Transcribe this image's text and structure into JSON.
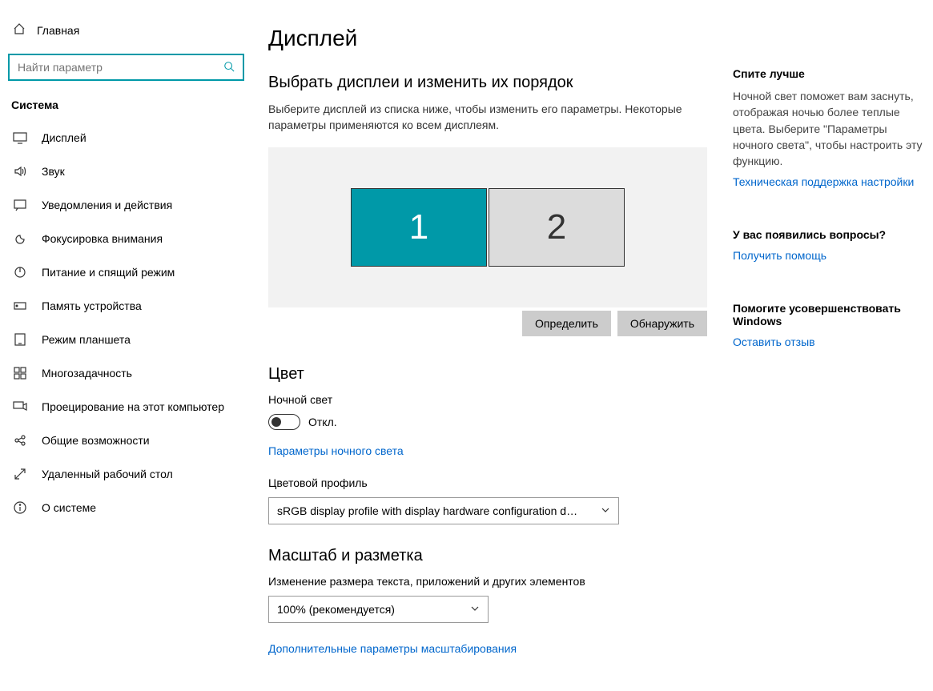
{
  "sidebar": {
    "home": "Главная",
    "search_placeholder": "Найти параметр",
    "category": "Система",
    "items": [
      {
        "label": "Дисплей"
      },
      {
        "label": "Звук"
      },
      {
        "label": "Уведомления и действия"
      },
      {
        "label": "Фокусировка внимания"
      },
      {
        "label": "Питание и спящий режим"
      },
      {
        "label": "Память устройства"
      },
      {
        "label": "Режим планшета"
      },
      {
        "label": "Многозадачность"
      },
      {
        "label": "Проецирование на этот компьютер"
      },
      {
        "label": "Общие возможности"
      },
      {
        "label": "Удаленный рабочий стол"
      },
      {
        "label": "О системе"
      }
    ]
  },
  "main": {
    "title": "Дисплей",
    "arrange": {
      "heading": "Выбрать дисплеи и изменить их порядок",
      "desc": "Выберите дисплей из списка ниже, чтобы изменить его параметры. Некоторые параметры применяются ко всем дисплеям.",
      "monitor1": "1",
      "monitor2": "2",
      "identify": "Определить",
      "detect": "Обнаружить"
    },
    "color": {
      "heading": "Цвет",
      "night_light": "Ночной свет",
      "toggle_state": "Откл.",
      "night_light_link": "Параметры ночного света",
      "profile_label": "Цветовой профиль",
      "profile_value": "sRGB display profile with display hardware configuration d…"
    },
    "scale": {
      "heading": "Масштаб и разметка",
      "label": "Изменение размера текста, приложений и других элементов",
      "value": "100% (рекомендуется)",
      "advanced_link": "Дополнительные параметры масштабирования"
    }
  },
  "right": {
    "sleep": {
      "title": "Спите лучше",
      "text": "Ночной свет поможет вам заснуть, отображая ночью более теплые цвета. Выберите \"Параметры ночного света\", чтобы настроить эту функцию.",
      "link": "Техническая поддержка настройки"
    },
    "questions": {
      "title": "У вас появились вопросы?",
      "link": "Получить помощь"
    },
    "feedback": {
      "title": "Помогите усовершенствовать Windows",
      "link": "Оставить отзыв"
    }
  }
}
